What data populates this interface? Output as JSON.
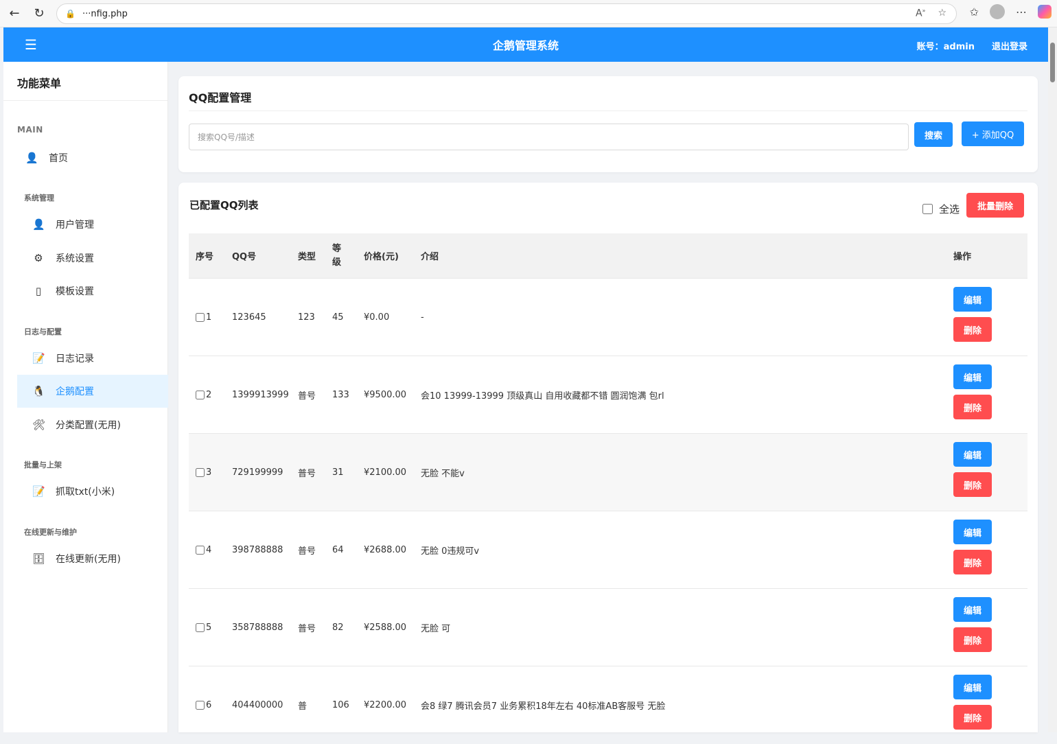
{
  "browser": {
    "url": "···nfig.php"
  },
  "header": {
    "title": "企鹅管理系统",
    "account": "账号：admin",
    "logout": "退出登录"
  },
  "sidebar": {
    "title": "功能菜单",
    "main_label": "MAIN",
    "home": "首页",
    "sections": {
      "system": "系统管理",
      "logs": "日志与配置",
      "batch": "批量与上架",
      "update": "在线更新与维护"
    },
    "items": {
      "users": "用户管理",
      "settings": "系统设置",
      "templates": "模板设置",
      "log_records": "日志记录",
      "penguin_config": "企鹅配置",
      "category_config": "分类配置(无用)",
      "grab_txt": "抓取txt(小米)",
      "online_update": "在线更新(无用)"
    }
  },
  "config_card": {
    "title": "QQ配置管理",
    "search_placeholder": "搜索QQ号/描述",
    "search_button": "搜索",
    "add_button": "+ 添加QQ"
  },
  "list_card": {
    "title": "已配置QQ列表",
    "select_all": "全选",
    "batch_delete": "批量删除",
    "columns": {
      "index": "序号",
      "qq": "QQ号",
      "type": "类型",
      "level_1": "等",
      "level_2": "级",
      "price": "价格(元)",
      "intro": "介绍",
      "actions": "操作"
    },
    "edit_label": "编辑",
    "delete_label": "删除",
    "rows": [
      {
        "index": "1",
        "qq": "123645",
        "type": "123",
        "level": "45",
        "price": "¥0.00",
        "intro": "-"
      },
      {
        "index": "2",
        "qq": "1399913999",
        "type": "普号",
        "level": "133",
        "price": "¥9500.00",
        "intro": "会10 13999-13999 顶级真山 自用收藏都不错 圆润饱满 包rl"
      },
      {
        "index": "3",
        "qq": "729199999",
        "type": "普号",
        "level": "31",
        "price": "¥2100.00",
        "intro": "无脸 不能v"
      },
      {
        "index": "4",
        "qq": "398788888",
        "type": "普号",
        "level": "64",
        "price": "¥2688.00",
        "intro": "无脸 0违规可v"
      },
      {
        "index": "5",
        "qq": "358788888",
        "type": "普号",
        "level": "82",
        "price": "¥2588.00",
        "intro": "无脸 可"
      },
      {
        "index": "6",
        "qq": "404400000",
        "type": "普",
        "level": "106",
        "price": "¥2200.00",
        "intro": "会8 绿7 腾讯会员7 业务累积18年左右 40标准AB客服号 无脸"
      }
    ]
  }
}
